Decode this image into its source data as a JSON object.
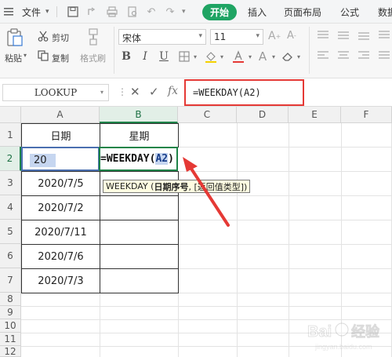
{
  "ribbon_tabs": {
    "file": "文件",
    "start": "开始",
    "insert": "插入",
    "page_layout": "页面布局",
    "formulas": "公式",
    "data": "数据"
  },
  "clipboard": {
    "paste": "粘贴",
    "cut": "剪切",
    "copy": "复制",
    "format_painter": "格式刷"
  },
  "font": {
    "name": "宋体",
    "size": "11",
    "bold": "B",
    "italic": "I",
    "underline": "U"
  },
  "formula_bar": {
    "name_box": "LOOKUP",
    "cancel": "✕",
    "enter": "✓",
    "fx": "fx",
    "formula": "=WEEKDAY(A2)"
  },
  "sheet": {
    "columns": [
      "A",
      "B",
      "C",
      "D",
      "E",
      "F"
    ],
    "rows": [
      "1",
      "2",
      "3",
      "4",
      "5",
      "6",
      "7",
      "8",
      "9",
      "10",
      "11",
      "12"
    ],
    "header_date": "日期",
    "header_weekday": "星期",
    "a2_visible": "20",
    "b2_formula_prefix": "=WEEKDAY(",
    "b2_formula_ref": "A2",
    "b2_formula_suffix": ")",
    "dates": [
      "2020/7/5",
      "2020/7/2",
      "2020/7/11",
      "2020/7/6",
      "2020/7/3"
    ],
    "tooltip_func": "WEEKDAY (",
    "tooltip_arg1": "日期序号",
    "tooltip_rest": ", [返回值类型])"
  },
  "colors": {
    "accent_green": "#1fa463",
    "highlight_red": "#e53935",
    "selection_blue": "#4a6fb0",
    "active_cell_green": "#1e8449"
  },
  "icons": [
    "hamburger-icon",
    "save-icon",
    "undo-icon",
    "redo-icon",
    "scissors-icon",
    "copy-icon",
    "paint-brush-icon",
    "clipboard-icon",
    "eraser-icon",
    "border-icon",
    "fill-color-icon",
    "font-color-icon",
    "cancel-icon",
    "check-icon",
    "fx-icon",
    "red-arrow-icon"
  ]
}
